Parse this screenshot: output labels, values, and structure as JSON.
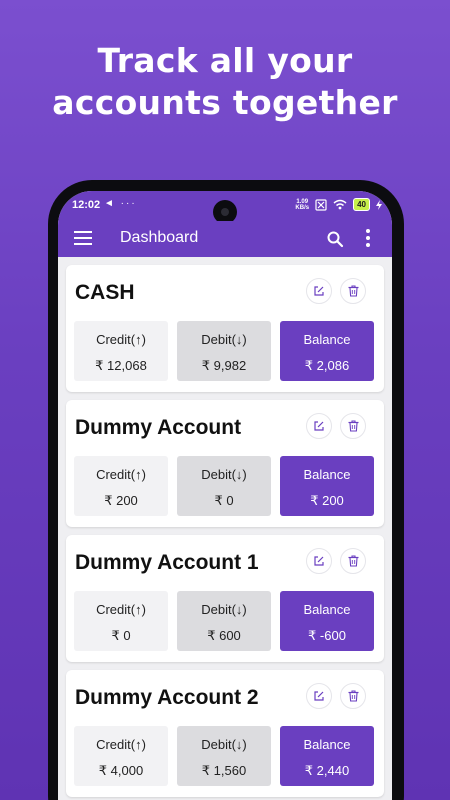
{
  "headline": {
    "line1": "Track all your",
    "line2": "accounts together"
  },
  "status": {
    "time": "12:02",
    "left_icons": "◄ ···",
    "speed_value": "1.09",
    "speed_unit": "KB/s",
    "battery": "40"
  },
  "appbar": {
    "title": "Dashboard"
  },
  "labels": {
    "credit": "Credit(↑)",
    "debit": "Debit(↓)",
    "balance": "Balance"
  },
  "accounts": [
    {
      "name": "CASH",
      "credit": "₹ 12,068",
      "debit": "₹ 9,982",
      "balance": "₹ 2,086"
    },
    {
      "name": "Dummy Account",
      "credit": "₹ 200",
      "debit": "₹ 0",
      "balance": "₹ 200"
    },
    {
      "name": "Dummy Account 1",
      "credit": "₹ 0",
      "debit": "₹ 600",
      "balance": "₹ -600"
    },
    {
      "name": "Dummy Account 2",
      "credit": "₹ 4,000",
      "debit": "₹ 1,560",
      "balance": "₹ 2,440"
    }
  ],
  "colors": {
    "primary": "#6a3fc0",
    "background_top": "#7b4fcf",
    "credit_tile": "#f2f2f4",
    "debit_tile": "#dcdcdf"
  },
  "icons": [
    "menu-icon",
    "search-icon",
    "more-vert-icon",
    "edit-icon",
    "delete-icon",
    "wifi-icon",
    "battery-icon"
  ]
}
